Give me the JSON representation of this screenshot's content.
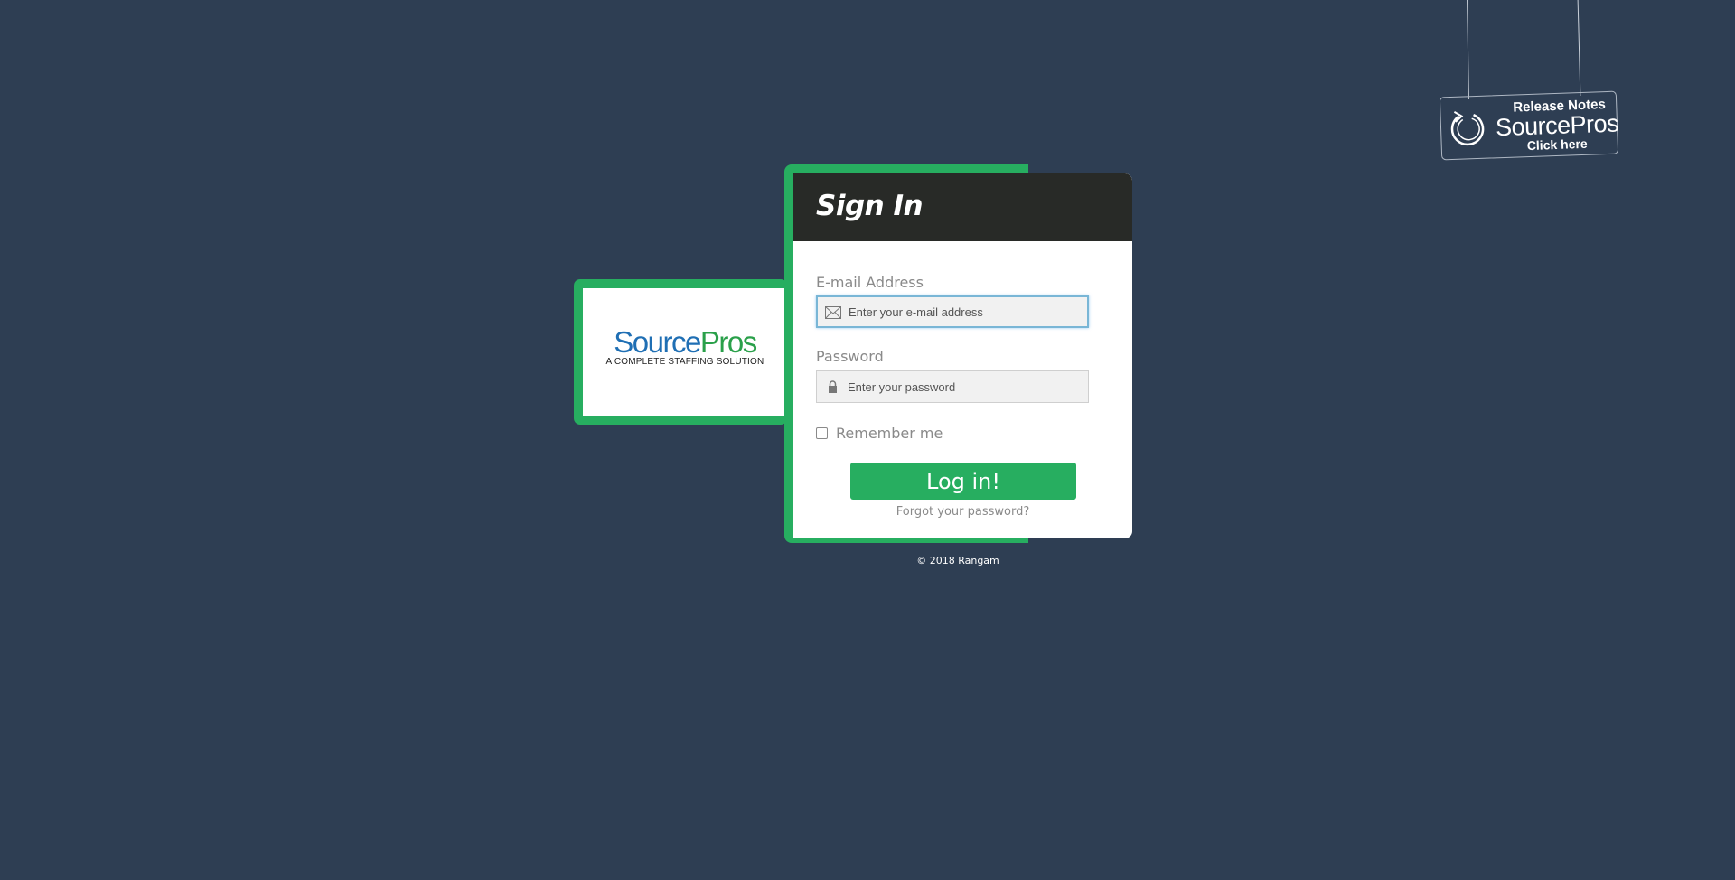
{
  "release_notes": {
    "title": "Release Notes",
    "brand": "SourcePros",
    "cta": "Click here",
    "icon": "refresh-circle-icon"
  },
  "logo": {
    "name_part1": "Source",
    "name_part2": "Pros",
    "tagline": "A COMPLETE STAFFING SOLUTION",
    "colors": {
      "source": "#1f6fb4",
      "pros": "#2aa04a"
    }
  },
  "signin": {
    "title": "Sign In",
    "email": {
      "label": "E-mail Address",
      "placeholder": "Enter your e-mail address",
      "value": "",
      "icon": "envelope-icon"
    },
    "password": {
      "label": "Password",
      "placeholder": "Enter your password",
      "value": "",
      "icon": "lock-icon"
    },
    "remember_label": "Remember me",
    "remember_checked": false,
    "login_label": "Log in!",
    "forgot_label": "Forgot your password?"
  },
  "footer": {
    "copyright": "© 2018 Rangam"
  },
  "colors": {
    "background": "#2e3e53",
    "accent": "#27ae60",
    "header": "#282a27"
  }
}
